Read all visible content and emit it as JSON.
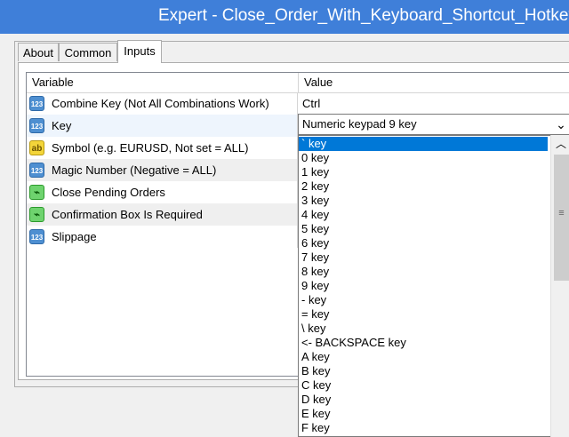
{
  "window": {
    "title": "Expert - Close_Order_With_Keyboard_Shortcut_Hotkeys"
  },
  "tabs": [
    {
      "label": "About"
    },
    {
      "label": "Common"
    },
    {
      "label": "Inputs",
      "active": true
    }
  ],
  "grid": {
    "headers": {
      "variable": "Variable",
      "value": "Value"
    },
    "rows": [
      {
        "icon": "number-icon",
        "icon_text": "123",
        "name": "Combine Key (Not All Combinations Work)",
        "value": "Ctrl"
      },
      {
        "icon": "number-icon",
        "icon_text": "123",
        "name": "Key",
        "value": "Numeric keypad 9 key"
      },
      {
        "icon": "string-icon",
        "icon_text": "ab",
        "name": "Symbol (e.g. EURUSD, Not set = ALL)",
        "value": ""
      },
      {
        "icon": "number-icon",
        "icon_text": "123",
        "name": "Magic Number (Negative = ALL)",
        "value": ""
      },
      {
        "icon": "bool-icon",
        "icon_text": "⌁",
        "name": "Close Pending Orders",
        "value": ""
      },
      {
        "icon": "bool-icon",
        "icon_text": "⌁",
        "name": "Confirmation Box Is Required",
        "value": ""
      },
      {
        "icon": "number-icon",
        "icon_text": "123",
        "name": "Slippage",
        "value": ""
      }
    ]
  },
  "key_select": {
    "value": "Numeric keypad 9 key",
    "options": [
      "` key",
      "0 key",
      "1 key",
      "2 key",
      "3 key",
      "4 key",
      "5 key",
      "6 key",
      "7 key",
      "8 key",
      "9 key",
      "- key",
      "= key",
      "\\ key",
      "<- BACKSPACE key",
      "A key",
      "B key",
      "C key",
      "D key",
      "E key",
      "F key"
    ],
    "highlighted": "` key"
  },
  "icons": {
    "dropdown": "chevron-down-icon",
    "scroll_up": "scroll-up-arrow-icon",
    "grip": "scroll-grip-icon"
  },
  "colors": {
    "titlebar": "#3f7fd9",
    "selection": "#0078d7"
  }
}
